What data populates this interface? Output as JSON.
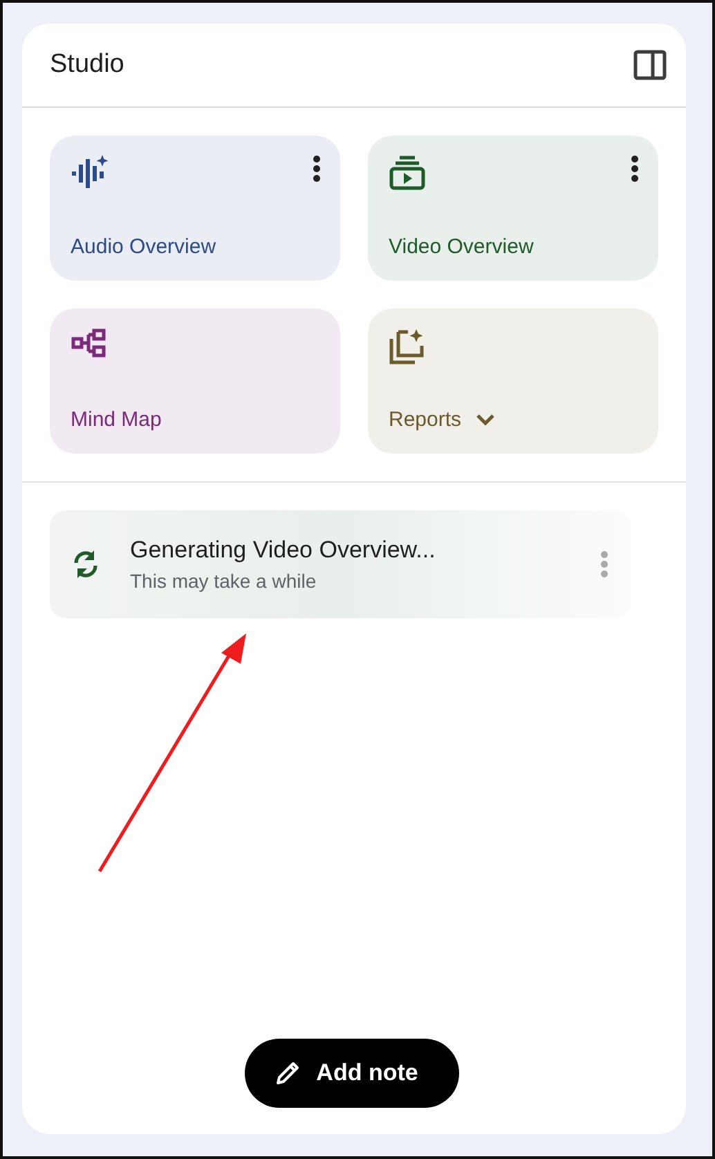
{
  "panel": {
    "title": "Studio"
  },
  "tiles": [
    {
      "label": "Audio Overview",
      "kind": "menu",
      "color": "#2d4a8a"
    },
    {
      "label": "Video Overview",
      "kind": "menu",
      "color": "#1e5a2a"
    },
    {
      "label": "Mind Map",
      "kind": "plain",
      "color": "#7a2a78"
    },
    {
      "label": "Reports",
      "kind": "dropdown",
      "color": "#6b5a2c"
    }
  ],
  "task": {
    "title": "Generating Video Overview...",
    "subtitle": "This may take a while"
  },
  "add_note": {
    "label": "Add note"
  }
}
